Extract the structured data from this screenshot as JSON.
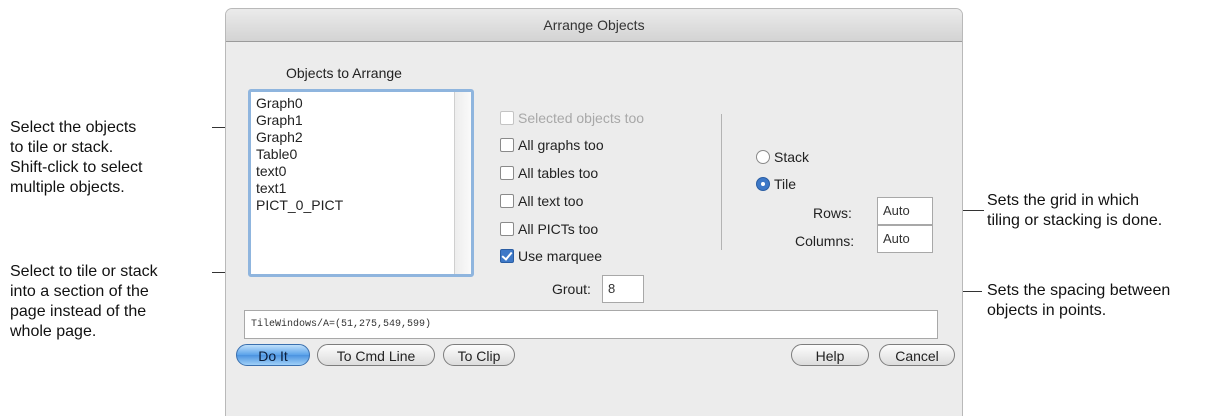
{
  "annotations": {
    "select_objects": [
      "Select the objects",
      "to tile or stack.",
      "Shift-click to select",
      "multiple objects."
    ],
    "select_marquee": [
      "Select to tile or stack",
      "into a section of the",
      "page instead of the",
      "whole page."
    ],
    "grid": [
      "Sets the grid in which",
      "tiling or stacking is done."
    ],
    "spacing": [
      "Sets the spacing between",
      "objects in points."
    ]
  },
  "dialog": {
    "title": "Arrange Objects",
    "list_label": "Objects to Arrange",
    "objects": [
      "Graph0",
      "Graph1",
      "Graph2",
      "Table0",
      "text0",
      "text1",
      "PICT_0_PICT"
    ],
    "checkboxes": [
      {
        "label": "Selected objects too",
        "checked": false,
        "enabled": false
      },
      {
        "label": "All graphs too",
        "checked": false,
        "enabled": true
      },
      {
        "label": "All tables too",
        "checked": false,
        "enabled": true
      },
      {
        "label": "All text too",
        "checked": false,
        "enabled": true
      },
      {
        "label": "All PICTs too",
        "checked": false,
        "enabled": true
      },
      {
        "label": "Use marquee",
        "checked": true,
        "enabled": true
      }
    ],
    "radios": [
      {
        "label": "Stack",
        "selected": false
      },
      {
        "label": "Tile",
        "selected": true
      }
    ],
    "rows_label": "Rows:",
    "rows_value": "Auto",
    "columns_label": "Columns:",
    "columns_value": "Auto",
    "grout_label": "Grout:",
    "grout_value": "8",
    "command": "TileWindows/A=(51,275,549,599)",
    "buttons": {
      "do_it": "Do It",
      "to_cmd_line": "To Cmd Line",
      "to_clip": "To Clip",
      "help": "Help",
      "cancel": "Cancel"
    }
  }
}
